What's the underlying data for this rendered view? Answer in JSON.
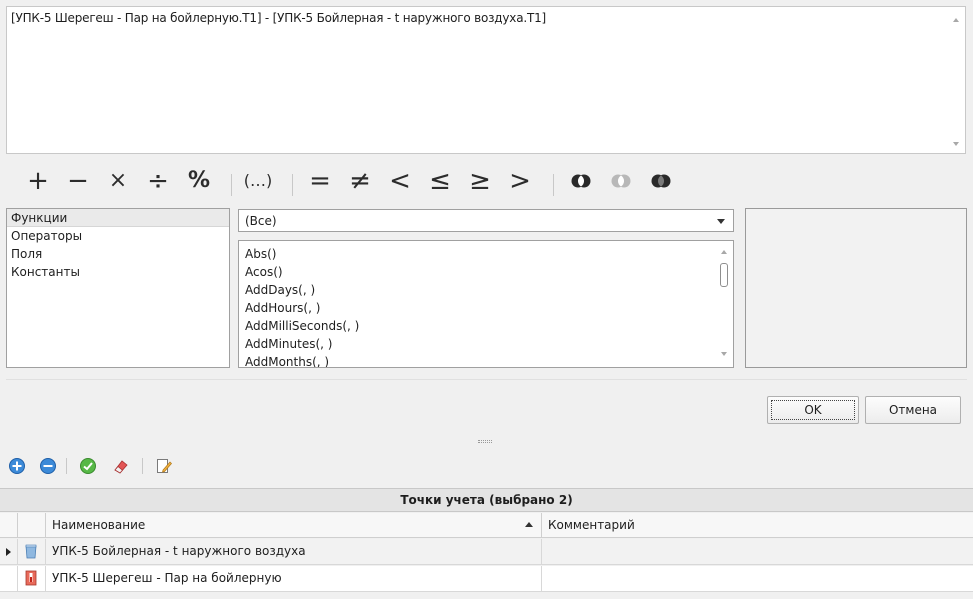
{
  "expression": "[УПК-5 Шерегеш - Пар на бойлерную.T1] - [УПК-5 Бойлерная - t наружного воздуха.T1]",
  "operators": {
    "plus": "+",
    "minus": "−",
    "multiply": "×",
    "divide": "÷",
    "percent": "%",
    "parens": "(…)",
    "equal": "=",
    "not_equal": "≠",
    "less": "<",
    "less_equal": "≤",
    "greater_equal": "≥",
    "greater": ">"
  },
  "categories": [
    "Функции",
    "Операторы",
    "Поля",
    "Константы"
  ],
  "filter": {
    "selected": "(Все)"
  },
  "functions": [
    "Abs()",
    "Acos()",
    "AddDays(, )",
    "AddHours(, )",
    "AddMilliSeconds(, )",
    "AddMinutes(, )",
    "AddMonths(, )"
  ],
  "buttons": {
    "ok": "OK",
    "cancel": "Отмена"
  },
  "toolbar_icons": [
    "add-icon",
    "remove-icon",
    "check-icon",
    "eraser-icon",
    "edit-document-icon"
  ],
  "grid": {
    "title": "Точки учета (выбрано 2)",
    "columns": {
      "name": "Наименование",
      "comment": "Комментарий"
    },
    "rows": [
      {
        "name": "УПК-5 Бойлерная - t наружного воздуха",
        "comment": "",
        "icon": "air-temperature-icon"
      },
      {
        "name": "УПК-5 Шерегеш - Пар на бойлерную",
        "comment": "",
        "icon": "thermometer-icon"
      }
    ]
  },
  "colors": {
    "accent_blue": "#2f7fd6",
    "accent_green": "#46a83a",
    "eraser_red": "#d84a4a"
  }
}
